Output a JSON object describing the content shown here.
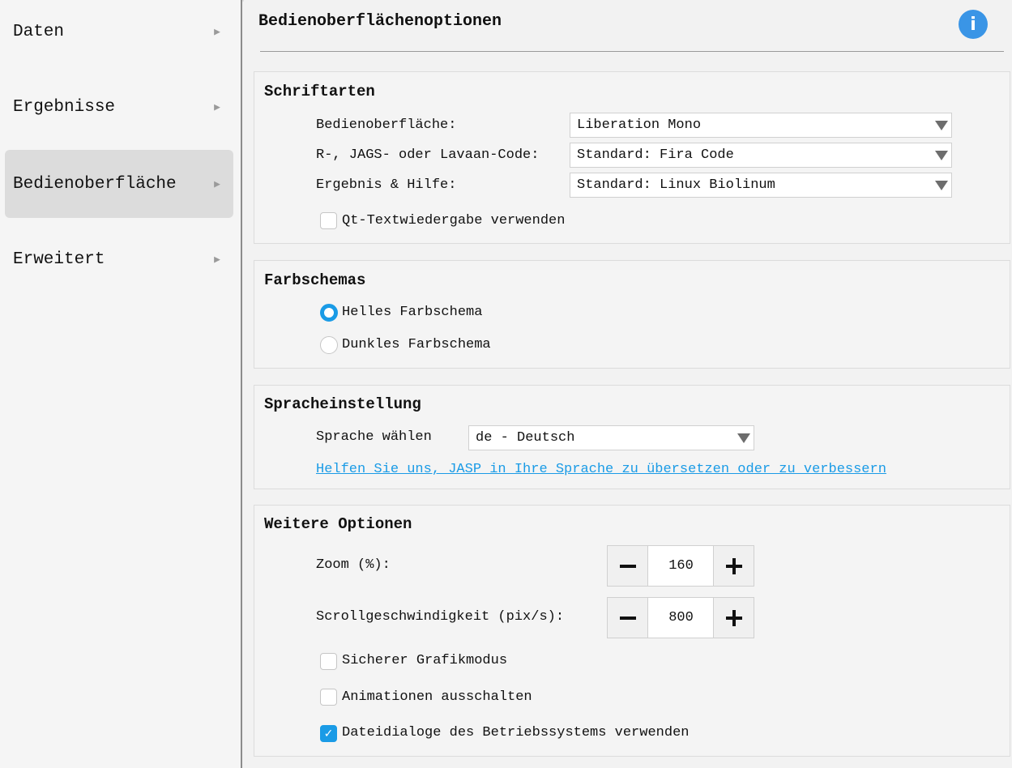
{
  "sidebar": {
    "items": [
      {
        "label": "Daten",
        "active": false
      },
      {
        "label": "Ergebnisse",
        "active": false
      },
      {
        "label": "Bedienoberfläche",
        "active": true
      },
      {
        "label": "Erweitert",
        "active": false
      }
    ]
  },
  "page": {
    "title": "Bedienoberflächenoptionen",
    "info_icon": "info-icon"
  },
  "fonts": {
    "title": "Schriftarten",
    "ui_label": "Bedienoberfläche:",
    "ui_value": "Liberation Mono",
    "code_label": "R-, JAGS- oder Lavaan-Code:",
    "code_value": "Standard: Fira Code",
    "results_label": "Ergebnis & Hilfe:",
    "results_value": "Standard: Linux Biolinum",
    "qt_label": "Qt-Textwiedergabe verwenden",
    "qt_checked": false
  },
  "themes": {
    "title": "Farbschemas",
    "light_label": "Helles Farbschema",
    "dark_label": "Dunkles Farbschema",
    "selected": "light"
  },
  "language": {
    "title": "Spracheinstellung",
    "label": "Sprache wählen",
    "value": "de - Deutsch",
    "help_link": "Helfen Sie uns, JASP in Ihre Sprache zu übersetzen oder zu verbessern"
  },
  "more": {
    "title": "Weitere Optionen",
    "zoom_label": "Zoom (%):",
    "zoom_value": "160",
    "scroll_label": "Scrollgeschwindigkeit (pix/s):",
    "scroll_value": "800",
    "safe_graphics_label": "Sicherer Grafikmodus",
    "safe_graphics_checked": false,
    "disable_anim_label": "Animationen ausschalten",
    "disable_anim_checked": false,
    "native_dialogs_label": "Dateidialoge des Betriebssystems verwenden",
    "native_dialogs_checked": true
  },
  "colors": {
    "accent": "#1a9be6",
    "info": "#3a95e6"
  }
}
